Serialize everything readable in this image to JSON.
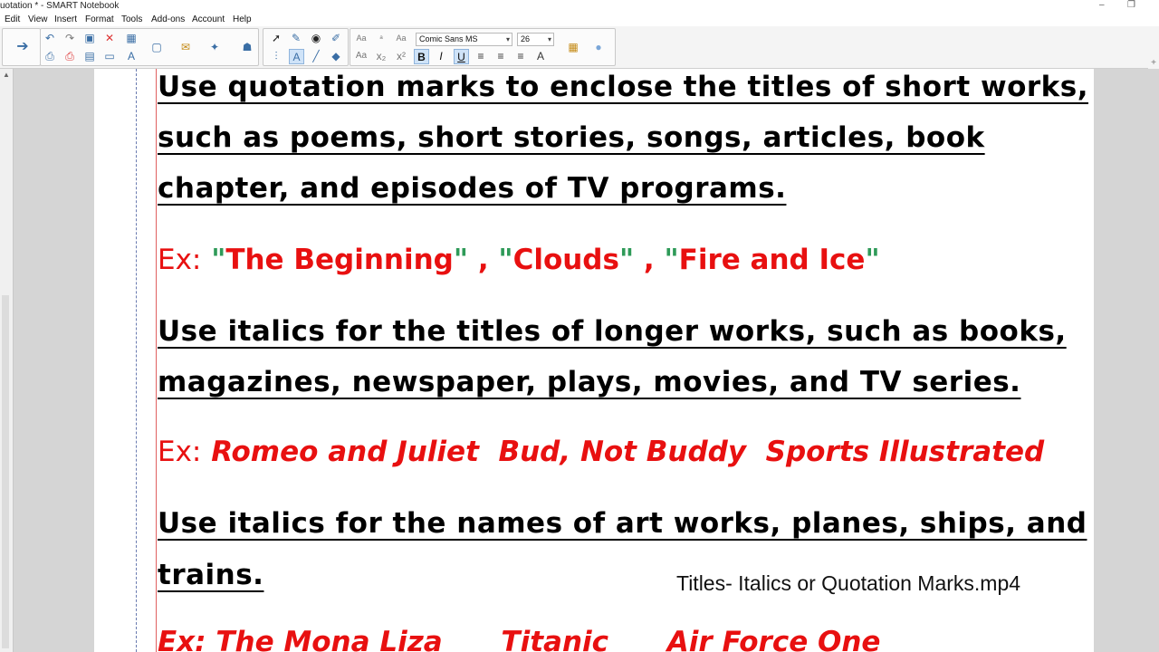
{
  "window": {
    "title": "uotation * - SMART Notebook",
    "controls": [
      "–",
      "❐"
    ]
  },
  "menu": [
    "Edit",
    "View",
    "Insert",
    "Format",
    "Tools",
    "Add-ons",
    "Account",
    "Help"
  ],
  "toolbar": {
    "font_name": "Comic Sans MS",
    "font_size": "26",
    "aa_label": "Aa"
  },
  "content": {
    "rule1_line1": "Use quotation marks to enclose the titles of short works,",
    "rule1_line2": "such as poems, short stories, songs, articles, book",
    "rule1_line3": "chapter, and episodes of TV programs.",
    "ex_label": "Ex:",
    "ex1": {
      "q": "\"",
      "t1": "The Beginning",
      "sep": " , ",
      "t2": "Clouds",
      "t3": "Fire and Ice"
    },
    "rule2_line1": "Use italics for the titles of longer works, such as books,",
    "rule2_line2": "magazines, newspaper, plays, movies, and TV series.",
    "ex2": "Romeo and Juliet  Bud, Not Buddy  Sports Illustrated",
    "rule3_line1": "Use italics for the names of art works, planes, ships, and",
    "rule3_line2": "trains.",
    "ex3": "The Mona Liza      Titanic      Air Force One",
    "caption": "Titles- Italics or Quotation Marks.mp4"
  },
  "colors": {
    "rule_text": "#000000",
    "example_text": "#e81010",
    "quote_marks": "#2e9a58",
    "page_lines": "#9cc3e0"
  }
}
